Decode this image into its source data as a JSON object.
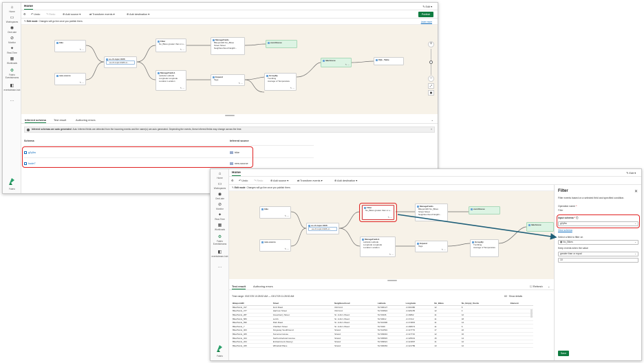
{
  "rail_items": [
    "Home",
    "Workspaces",
    "OneLake",
    "Monitor",
    "Real-Time",
    "Workloads",
    "Fabric Eventstreams",
    "eventstream-hub"
  ],
  "rail_logo": "Fabric",
  "tab_home": "Home",
  "edit_label": "Edit",
  "toolbar": {
    "undo": "Undo",
    "redo": "Redo",
    "add_source": "Add source",
    "transform_events": "Transform events",
    "add_destination": "Add destination",
    "publish": "Publish"
  },
  "edit_mode": {
    "title": "Edit mode",
    "desc": "Changes will go live once you publish them.",
    "learn_more": "Learn more"
  },
  "nodes": {
    "bike": {
      "title": "bike"
    },
    "new_source": {
      "title": "new-source"
    },
    "eventstream": {
      "title": "es-ch-topic-0426",
      "line": "es-ch-topic-0426-st..."
    },
    "filter": {
      "title": "Filter",
      "line": "No_Bikes greater than or e..."
    },
    "manage1": {
      "title": "ManageFields",
      "lines": [
        "BikepointID  No_Bikes",
        "Street  Street",
        "Neighbourhood  Neighb..."
      ]
    },
    "manage2": {
      "title": "ManageFields1",
      "lines": [
        "Latitude  Latitude",
        "Longitude  Longitude",
        "Location  Location"
      ]
    },
    "expand": {
      "title": "Expand",
      "line": "Tags"
    },
    "groupby": {
      "title": "GroupBy",
      "lines": [
        "Tumbling",
        "Average of Temperature"
      ]
    },
    "eventhouse": {
      "title": "eventhouse"
    },
    "lakehouse": {
      "title": "lakehouse"
    },
    "kqlstream": {
      "title": "KQL_Table"
    }
  },
  "lower_tabs_w1": [
    "Inferred schema",
    "Test result",
    "Authoring errors"
  ],
  "info_w1": {
    "bold": "Inferred schemas are auto generated",
    "text": "Auto Inferred fields are detected from the incoming events and the name(s) are auto generated. Depending the events, these inferred fields may change across the time."
  },
  "schema_table": {
    "col_schema": "Schema",
    "col_source": "Inferred source",
    "rows": [
      {
        "schema": "g2y5w",
        "source": "bike"
      },
      {
        "schema": "hode7",
        "source": "new-source"
      }
    ]
  },
  "lower_tabs_w2": [
    "Test result",
    "Authoring errors"
  ],
  "refresh": "Refresh",
  "time_range": {
    "label": "Time range:",
    "value": "03/17/25 10:28:52 AM — 03/17/25 11:28:52 AM",
    "results": "60",
    "show_details": "Show details"
  },
  "result_table": {
    "columns": [
      "BikepointID",
      "Street",
      "Neighbourhood",
      "Latitude",
      "Longitude",
      "No_Bikes",
      "No_Empty_Docks",
      "Element"
    ],
    "rows": [
      [
        "BikePoints_317",
        "Ford Road",
        "Old Ford",
        "51.530127",
        "-0.032480",
        "12",
        "6",
        ""
      ],
      [
        "BikePoints_477",
        "Harrison Street",
        "Old Ford",
        "51.533824",
        "-0.029155",
        "12",
        "4",
        ""
      ],
      [
        "BikePoints_287",
        "Greenberry Street",
        "St. John's Wood",
        "51.53336",
        "-0.16862",
        "11",
        "12",
        ""
      ],
      [
        "BikePoints_583",
        "Lord's",
        "St. John's Wood",
        "51.52912",
        "-0.17212",
        "11",
        "18",
        ""
      ],
      [
        "BikePoints_596",
        "Park Road",
        "St. John's Wood",
        "51.521996",
        "-0.174815",
        "11",
        "14",
        ""
      ],
      [
        "BikePoints_7",
        "Charlbert Street",
        "St. John's Wood",
        "51.5340",
        "-0.168074",
        "11",
        "6",
        ""
      ],
      [
        "BikePoints_403",
        "Kingsway Southbound",
        "Strand",
        "51.514591",
        "-0.117779",
        "17",
        "22",
        ""
      ],
      [
        "BikePoints_405",
        "Somerset House",
        "Strand",
        "51.509943",
        "-0.117719",
        "12",
        "16",
        ""
      ],
      [
        "BikePoints_324",
        "Northumberland Avenue",
        "Strand",
        "51.505815",
        "-0.125631",
        "15",
        "14",
        ""
      ],
      [
        "BikePoints_324",
        "Embankment (Savoy)",
        "Strand",
        "51.509621",
        "-0.121807",
        "11",
        "12",
        ""
      ],
      [
        "BikePoints_325",
        "Whitehall Place",
        "Strand",
        "51.506063",
        "-0.121789",
        "13",
        "12",
        ""
      ]
    ]
  },
  "filter_panel": {
    "title": "Filter",
    "desc": "Filter events based on a selected field and specified condition.",
    "op_label": "Operation name",
    "op_value": "Filter",
    "schema_label": "Input schema",
    "schema_value": "g2y5w",
    "schema_link": "View schema",
    "field_label": "Select a field to filter on",
    "field_value": "No_Bikes",
    "keep_label": "Keep events when the value",
    "condition_value": "greater than or equal",
    "threshold_value": "10",
    "save": "Save"
  },
  "colors": {
    "accent": "#107c41",
    "highlight": "#e02020",
    "arrow": "#1f5f78"
  }
}
